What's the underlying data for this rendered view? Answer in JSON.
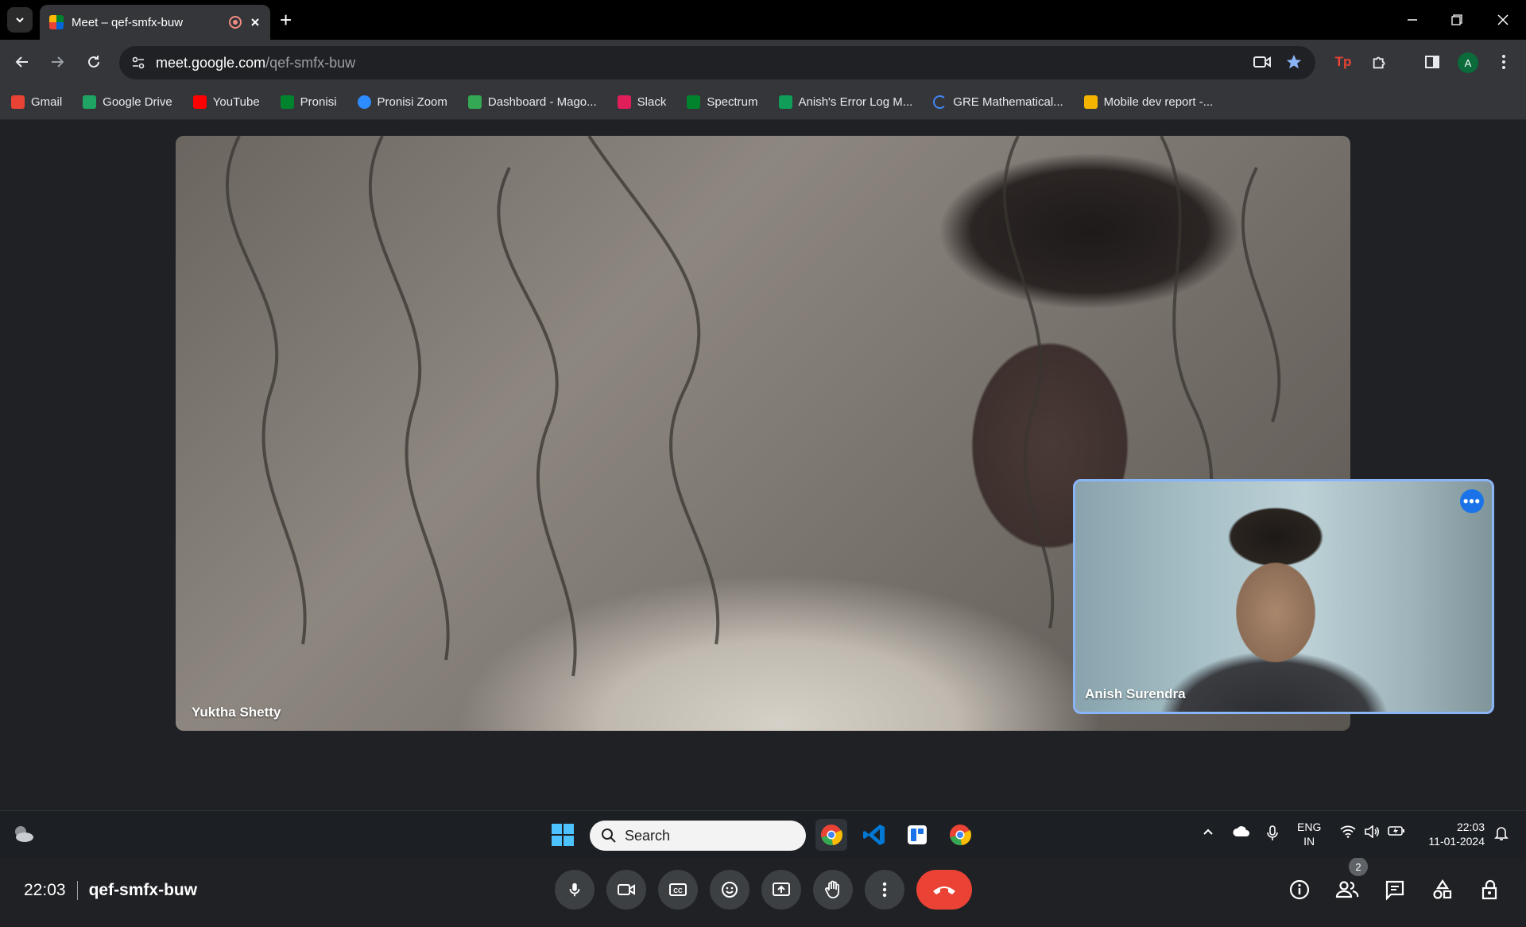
{
  "browser": {
    "tab_title": "Meet – qef-smfx-buw",
    "url_host": "meet.google.com",
    "url_path": "/qef-smfx-buw",
    "profile_initial": "A",
    "bookmarks": [
      {
        "label": "Gmail",
        "color": "#ea4335"
      },
      {
        "label": "Google Drive",
        "color": "#1fa463"
      },
      {
        "label": "YouTube",
        "color": "#ff0000"
      },
      {
        "label": "Pronisi",
        "color": "#00832d"
      },
      {
        "label": "Pronisi Zoom",
        "color": "#2d8cff"
      },
      {
        "label": "Dashboard - Mago...",
        "color": "#34a853"
      },
      {
        "label": "Slack",
        "color": "#e01e5a"
      },
      {
        "label": "Spectrum",
        "color": "#00832d"
      },
      {
        "label": "Anish's Error Log M...",
        "color": "#0f9d58"
      },
      {
        "label": "GRE Mathematical...",
        "color": "#4285f4"
      },
      {
        "label": "Mobile dev report -...",
        "color": "#f4b400"
      }
    ]
  },
  "meet": {
    "main_participant": "Yuktha Shetty",
    "self_participant": "Anish Surendra",
    "time": "22:03",
    "meeting_code": "qef-smfx-buw",
    "participant_count": "2",
    "pip_more_label": "•••"
  },
  "taskbar": {
    "search_placeholder": "Search",
    "lang_line1": "ENG",
    "lang_line2": "IN",
    "time": "22:03",
    "date": "11-01-2024"
  }
}
